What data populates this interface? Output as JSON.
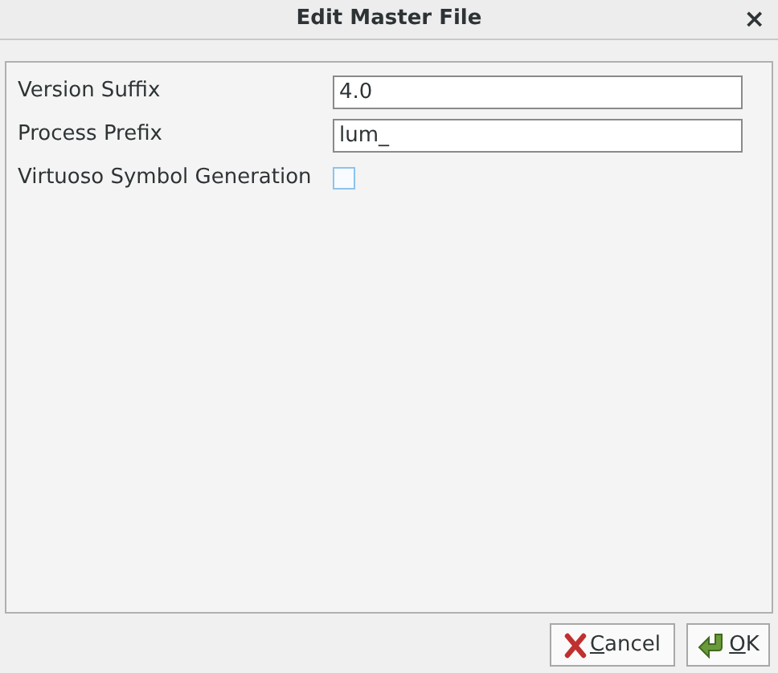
{
  "window": {
    "title": "Edit Master File",
    "close": "×"
  },
  "fields": [
    {
      "kind": "text",
      "label": "Version Suffix",
      "value": "4.0"
    },
    {
      "kind": "text",
      "label": "Process Prefix",
      "value": "lum_"
    },
    {
      "kind": "checkbox",
      "label": "Virtuoso Symbol Generation",
      "checked": false
    }
  ],
  "buttons": [
    {
      "kind": "cancel",
      "mnemonic": "C",
      "rest": "ancel"
    },
    {
      "kind": "ok",
      "mnemonic": "O",
      "rest": "K"
    }
  ]
}
